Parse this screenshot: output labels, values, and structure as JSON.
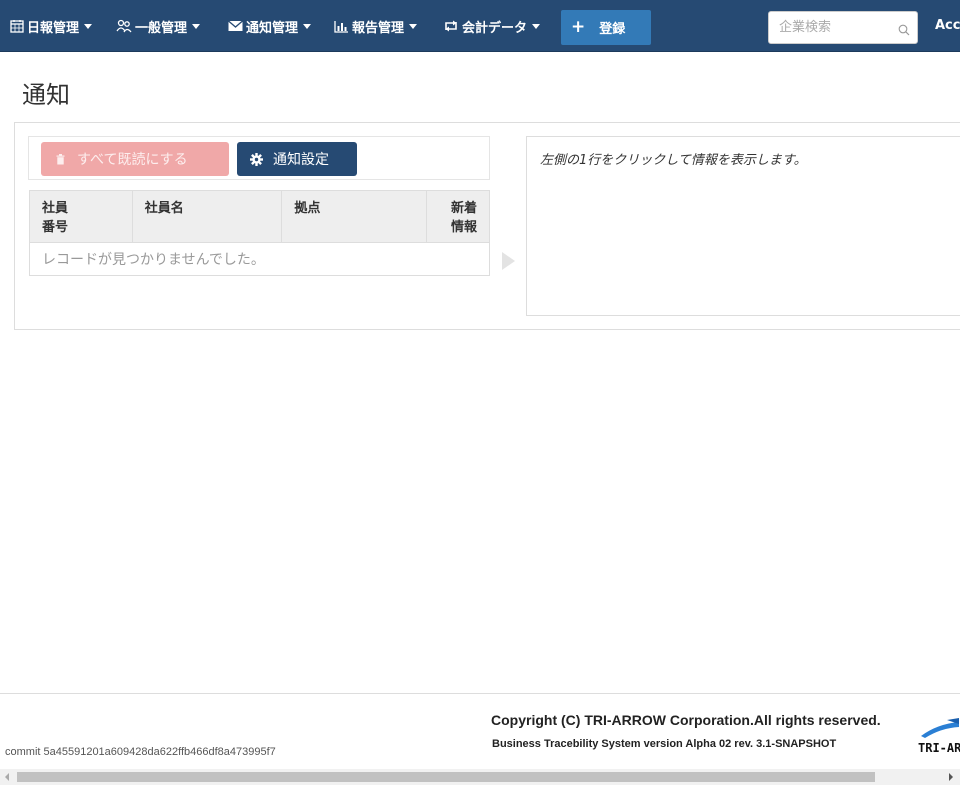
{
  "nav": {
    "items": [
      {
        "label": "日報管理",
        "icon": "calendar-icon"
      },
      {
        "label": "一般管理",
        "icon": "users-icon"
      },
      {
        "label": "通知管理",
        "icon": "envelope-icon"
      },
      {
        "label": "報告管理",
        "icon": "bar-chart-icon"
      },
      {
        "label": "会計データ",
        "icon": "retweet-icon"
      }
    ],
    "register_label": "登録",
    "search_placeholder": "企業検索",
    "account_label": "Acc"
  },
  "page": {
    "title": "通知"
  },
  "toolbar": {
    "read_all_label": "すべて既読にする",
    "settings_label": "通知設定"
  },
  "table": {
    "columns": [
      "社員\n番号",
      "社員名",
      "拠点",
      "新着\n情報"
    ],
    "empty_message": "レコードが見つかりませんでした。"
  },
  "detail": {
    "hint": "左側の1行をクリックして情報を表示します。"
  },
  "footer": {
    "copyright": "Copyright (C) TRI-ARROW Corporation.All rights reserved.",
    "version": "Business Tracebility System version Alpha 02 rev. 3.1-SNAPSHOT",
    "commit": "commit 5a45591201a609428da622ffb466df8a473995f7",
    "logo_text": "TRI-ARROW"
  },
  "colors": {
    "navbar": "#264a73",
    "primary": "#337ab7",
    "danger_disabled": "#f0a8a8"
  }
}
